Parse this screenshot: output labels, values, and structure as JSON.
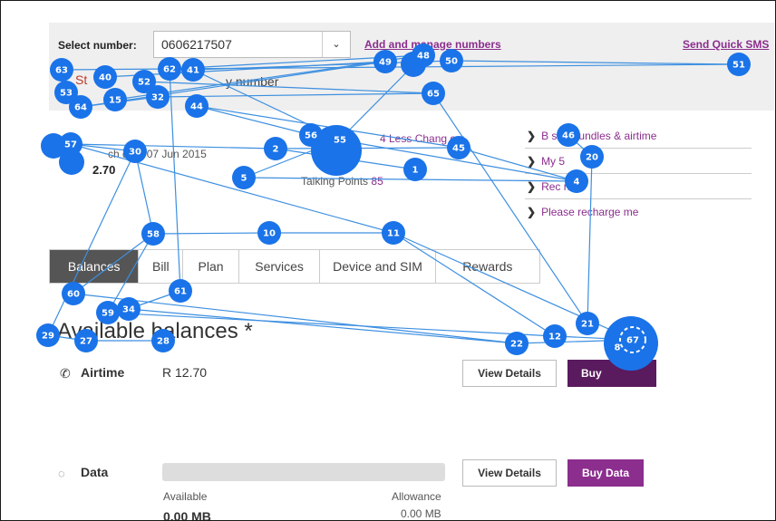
{
  "header": {
    "select_label": "Select number:",
    "selected_number": "0606217507",
    "dropdown_icon": "chevron-down-icon",
    "add_manage_link": "Add and manage numbers",
    "send_sms_link": "Send Quick SMS",
    "primary_text": "y number",
    "red_fragment": "St"
  },
  "summary": {
    "airtime_small": "ch  date 07 Jun 2015",
    "airtime_big": "2.70",
    "talking_points_label": "Talking Points",
    "talking_points_value": "85",
    "less_change_text": "4 Less Chang      ow"
  },
  "side_links": [
    {
      "label": "B   sfer bundles & airtime"
    },
    {
      "label": "My 5"
    },
    {
      "label": "Rec       now"
    },
    {
      "label": "Please recharge me"
    }
  ],
  "tabs": [
    {
      "label": "Balances",
      "active": true
    },
    {
      "label": "Bill",
      "active": false
    },
    {
      "label": "Plan",
      "active": false
    },
    {
      "label": "Services",
      "active": false
    },
    {
      "label": "Device and SIM",
      "active": false
    },
    {
      "label": "Rewards",
      "active": false
    }
  ],
  "main": {
    "heading": "Available balances *",
    "airtime": {
      "label": "Airtime",
      "icon": "phone-icon",
      "value": "R 12.70",
      "view_details": "View Details",
      "buy_label": "Buy"
    },
    "data": {
      "label": "Data",
      "icon": "data-icon",
      "view_details": "View Details",
      "buy_label": "Buy Data",
      "available_label": "Available",
      "allowance_label": "Allowance",
      "available_value": "0.00 MB",
      "allowance_value": "0.00 MB",
      "usage_fraction": 0
    }
  },
  "colors": {
    "accent": "#8b2e8e",
    "accent_dark": "#5a1a5e",
    "marker": "#1a73e8",
    "line": "#3d8fe0",
    "tab_active": "#555555"
  },
  "markers": [
    {
      "label": "1"
    },
    {
      "label": "2"
    },
    {
      "label": "4"
    },
    {
      "label": "5"
    },
    {
      "label": "8"
    },
    {
      "label": "10"
    },
    {
      "label": "11"
    },
    {
      "label": "12"
    },
    {
      "label": "15"
    },
    {
      "label": "20"
    },
    {
      "label": "21"
    },
    {
      "label": "22"
    },
    {
      "label": "27"
    },
    {
      "label": "28"
    },
    {
      "label": "29"
    },
    {
      "label": "30"
    },
    {
      "label": "32"
    },
    {
      "label": "34"
    },
    {
      "label": "40"
    },
    {
      "label": "41"
    },
    {
      "label": "44"
    },
    {
      "label": "45"
    },
    {
      "label": "46"
    },
    {
      "label": "48"
    },
    {
      "label": "49"
    },
    {
      "label": "50"
    },
    {
      "label": "51"
    },
    {
      "label": "52"
    },
    {
      "label": "53"
    },
    {
      "label": "55"
    },
    {
      "label": "56"
    },
    {
      "label": "57"
    },
    {
      "label": "58"
    },
    {
      "label": "59"
    },
    {
      "label": "60"
    },
    {
      "label": "61"
    },
    {
      "label": "62"
    },
    {
      "label": "63"
    },
    {
      "label": "64"
    },
    {
      "label": "65"
    },
    {
      "label": "67"
    }
  ]
}
